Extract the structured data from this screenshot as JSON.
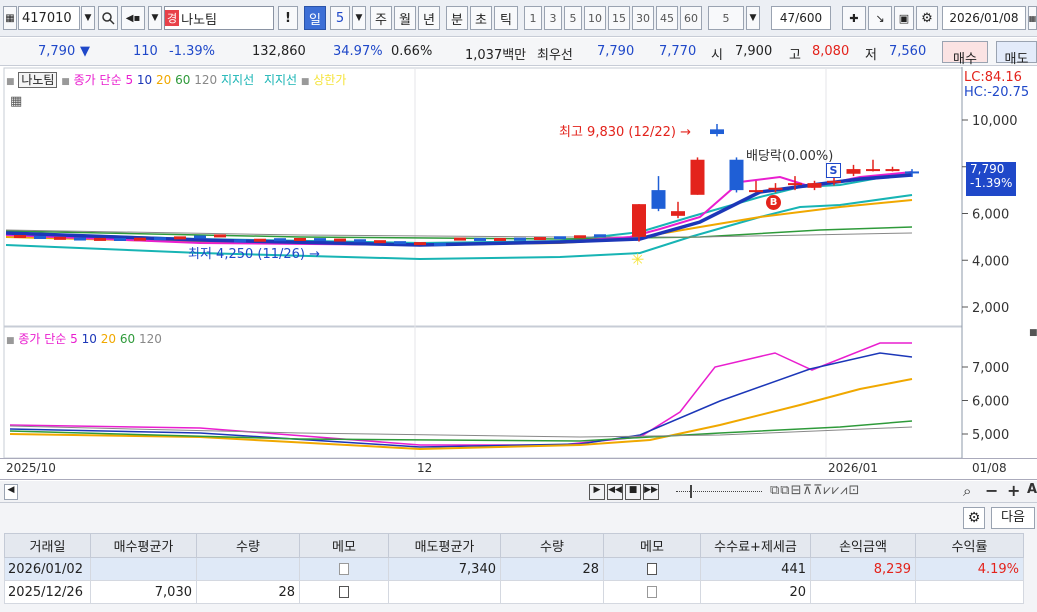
{
  "toolbar": {
    "code": "417010",
    "stock_badge": "경",
    "stock_name": "나노팀",
    "buttons": [
      "!",
      "일",
      "5",
      "주",
      "월",
      "년",
      "분",
      "초",
      "틱"
    ],
    "periods": [
      "1",
      "3",
      "5",
      "10",
      "15",
      "30",
      "45",
      "60"
    ],
    "period_select": "5",
    "count": "47/600",
    "date": "2026/01/08"
  },
  "quote": {
    "price": "7,790",
    "arrow": "▼",
    "change": "110",
    "change_pct": "-1.39%",
    "volume": "132,860",
    "volume_ratio": "34.97%",
    "turnover_rate": "0.66%",
    "amount": "1,037백만",
    "best_label": "최우선",
    "ask": "7,790",
    "bid": "7,770",
    "open_label": "시",
    "open": "7,900",
    "high_label": "고",
    "high": "8,080",
    "low_label": "저",
    "low": "7,560",
    "buy_button": "매수",
    "sell_button": "매도"
  },
  "chart": {
    "legend_main": {
      "name": "나노팀",
      "ma_label": "종가 단순",
      "periods": [
        "5",
        "10",
        "20",
        "60",
        "120"
      ],
      "support1": "지지선",
      "support2": "지지선",
      "upper": "상한가"
    },
    "lc": "LC:84.16",
    "hc": "HC:-20.75",
    "price_ticks": [
      "10,000",
      "8,000",
      "6,000",
      "4,000",
      "2,000"
    ],
    "last_price": "7,790",
    "last_change": "-1.39%",
    "high_annot": "최고 9,830 (12/22)",
    "low_annot": "최저 4,250 (11/26)",
    "dividend_annot": "배당락(0.00%)",
    "sub_legend": {
      "ma_label": "종가 단순",
      "periods": [
        "5",
        "10",
        "20",
        "60",
        "120"
      ]
    },
    "sub_ticks": [
      "7,000",
      "6,000",
      "5,000"
    ],
    "x_labels": [
      "2025/10",
      "12",
      "2026/01",
      "01/08"
    ],
    "colors": {
      "ma5": "#e91ecf",
      "ma10": "#1c37b8",
      "ma20": "#f0a800",
      "ma60": "#2e9a3a",
      "ma120": "#888888",
      "up": "#e3231c",
      "down": "#1f5fd6"
    }
  },
  "chart_data": {
    "type": "candlestick",
    "notes_levels": {
      "high": 9830,
      "low": 4250
    },
    "recent_candles": [
      {
        "label": "c1",
        "open": 5000,
        "close": 6400,
        "high": 6400,
        "low": 4800
      },
      {
        "label": "c2",
        "open": 7000,
        "close": 6200,
        "high": 7600,
        "low": 6100
      },
      {
        "label": "c3",
        "open": 5900,
        "close": 6100,
        "high": 6500,
        "low": 5800
      },
      {
        "label": "c4",
        "open": 6800,
        "close": 8300,
        "high": 8400,
        "low": 6800
      },
      {
        "label": "c5",
        "open": 9600,
        "close": 9400,
        "high": 9830,
        "low": 9300
      },
      {
        "label": "c6",
        "open": 8300,
        "close": 7000,
        "high": 8400,
        "low": 6900
      },
      {
        "label": "c7",
        "open": 7000,
        "close": 7000,
        "high": 7400,
        "low": 6900
      },
      {
        "label": "c8",
        "open": 7100,
        "close": 7100,
        "high": 7300,
        "low": 6900
      },
      {
        "label": "c9",
        "open": 7300,
        "close": 7300,
        "high": 7600,
        "low": 7000
      },
      {
        "label": "c10",
        "open": 7100,
        "close": 7300,
        "high": 7400,
        "low": 7000
      },
      {
        "label": "c11",
        "open": 7400,
        "close": 7400,
        "high": 7600,
        "low": 7200
      },
      {
        "label": "c12",
        "open": 7700,
        "close": 7900,
        "high": 8080,
        "low": 7600
      },
      {
        "label": "c13",
        "open": 7900,
        "close": 7900,
        "high": 8300,
        "low": 7800
      },
      {
        "label": "c14",
        "open": 7900,
        "close": 7900,
        "high": 8000,
        "low": 7800
      },
      {
        "label": "c15",
        "open": 7800,
        "close": 7790,
        "high": 7900,
        "low": 7560
      }
    ]
  },
  "scroll": {
    "zoom_icons": [
      "zoom-out",
      "minus",
      "plus"
    ]
  },
  "trades": {
    "next_button": "다음",
    "headers": [
      "거래일",
      "매수평균가",
      "수량",
      "메모",
      "매도평균가",
      "수량",
      "메모",
      "수수료+제세금",
      "손익금액",
      "수익률"
    ],
    "rows": [
      {
        "date": "2026/01/02",
        "buy_avg": "",
        "buy_qty": "",
        "sell_avg": "7,340",
        "sell_qty": "28",
        "fee": "441",
        "pnl": "8,239",
        "rate": "4.19%"
      },
      {
        "date": "2025/12/26",
        "buy_avg": "7,030",
        "buy_qty": "28",
        "sell_avg": "",
        "sell_qty": "",
        "fee": "20",
        "pnl": "",
        "rate": ""
      }
    ]
  }
}
